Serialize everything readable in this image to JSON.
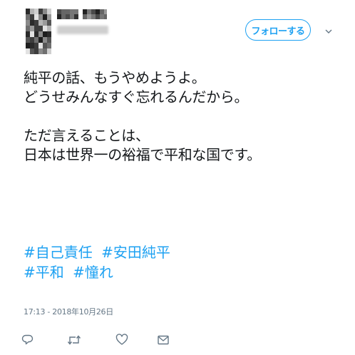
{
  "header": {
    "follow_label": "フォローする"
  },
  "icons": {
    "avatar": "avatar",
    "caret": "chevron-down-icon",
    "reply": "reply-icon",
    "retweet": "retweet-icon",
    "like": "heart-icon",
    "dm": "envelope-icon"
  },
  "tweet": {
    "lines": [
      "純平の話、もうやめようよ。",
      "どうせみんなすぐ忘れるんだから。",
      "",
      "ただ言えることは、",
      "日本は世界一の裕福で平和な国です。"
    ],
    "hashtags_row1": [
      "#自己責任",
      "#安田純平"
    ],
    "hashtags_row2": [
      "#平和",
      "#憧れ"
    ]
  },
  "meta": {
    "timestamp": "17:13 - 2018年10月26日"
  },
  "colors": {
    "accent": "#1da1f2",
    "text": "#14171a",
    "muted": "#657786"
  }
}
